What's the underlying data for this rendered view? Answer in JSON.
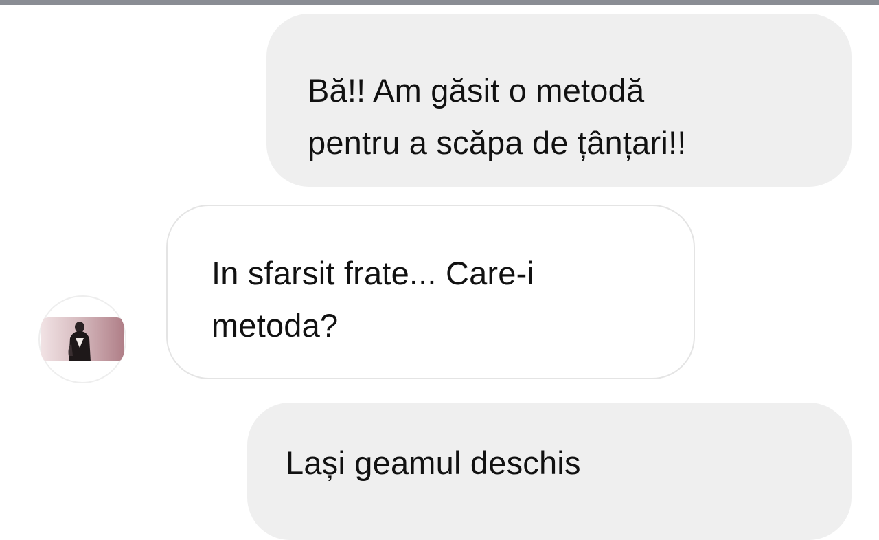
{
  "conversation": {
    "messages": [
      {
        "direction": "sent",
        "text": "Bă!! Am găsit o metodă\npentru a scăpa de țânțari!!"
      },
      {
        "direction": "received",
        "text": "In sfarsit frate... Care-i\nmetoda?"
      },
      {
        "direction": "sent",
        "text": "Lași geamul deschis"
      }
    ],
    "contact": {
      "avatar": "contact-photo"
    }
  },
  "colors": {
    "sent_bubble": "#efefef",
    "received_bubble": "#ffffff",
    "received_border": "#e4e4e4",
    "text": "#111111",
    "top_strip": "#8a8d94"
  }
}
